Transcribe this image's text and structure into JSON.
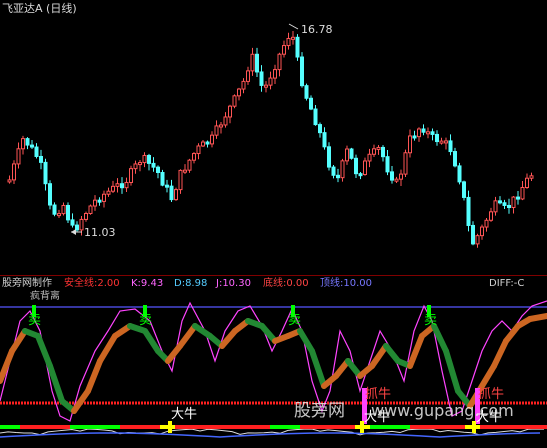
{
  "chart": {
    "title": "飞亚达A",
    "period": "(日线)",
    "high_label": "16.78",
    "low_label": "11.03"
  },
  "indicator": {
    "name": "股旁网制作",
    "safe_line": "安全线:2.00",
    "k": "K:9.43",
    "d": "D:8.98",
    "j": "J:10.30",
    "bottom_line": "底线:0.00",
    "top_line": "顶线:10.00",
    "diff": "DIFF:-C",
    "sub_label": "疯背离"
  },
  "signals": {
    "sell": "卖",
    "big_bull": "大牛",
    "catch_bull": "抓牛"
  },
  "watermark": {
    "cn": "股旁网",
    "url": "www.gupang.com"
  },
  "colors": {
    "up": "#ff5555",
    "down": "#55ffff",
    "k_line": "#ff44ff",
    "d_line_up": "#cc6622",
    "d_line_down": "#228833",
    "safe_line": "#ff2020",
    "top_line": "#5555ff",
    "signal_green": "#00ff00",
    "signal_yellow": "#ffff00"
  }
}
